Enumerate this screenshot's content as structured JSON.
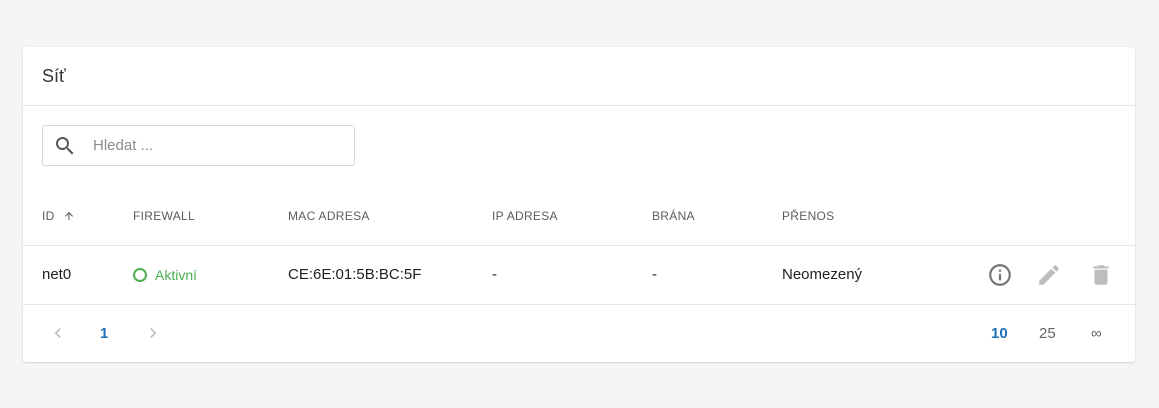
{
  "card": {
    "title": "Síť"
  },
  "search": {
    "placeholder": "Hledat ..."
  },
  "table": {
    "columns": [
      "ID",
      "FIREWALL",
      "MAC ADRESA",
      "IP ADRESA",
      "BRÁNA",
      "PŘENOS"
    ],
    "rows": [
      {
        "id": "net0",
        "firewall": "Aktivní",
        "mac": "CE:6E:01:5B:BC:5F",
        "ip": "-",
        "gateway": "-",
        "transfer": "Neomezený"
      }
    ]
  },
  "pagination": {
    "current_page": "1",
    "page_sizes": [
      "10",
      "25",
      "∞"
    ],
    "selected_size": "10"
  },
  "colors": {
    "accent": "#1e6fb5",
    "status_active": "#4caf50",
    "icon_gray": "#757575",
    "icon_disabled": "#bdbdbd"
  },
  "icons": [
    "search-icon",
    "sort-arrow-up-icon",
    "status-circle-icon",
    "info-icon",
    "edit-icon",
    "delete-icon",
    "chevron-left-icon",
    "chevron-right-icon"
  ]
}
